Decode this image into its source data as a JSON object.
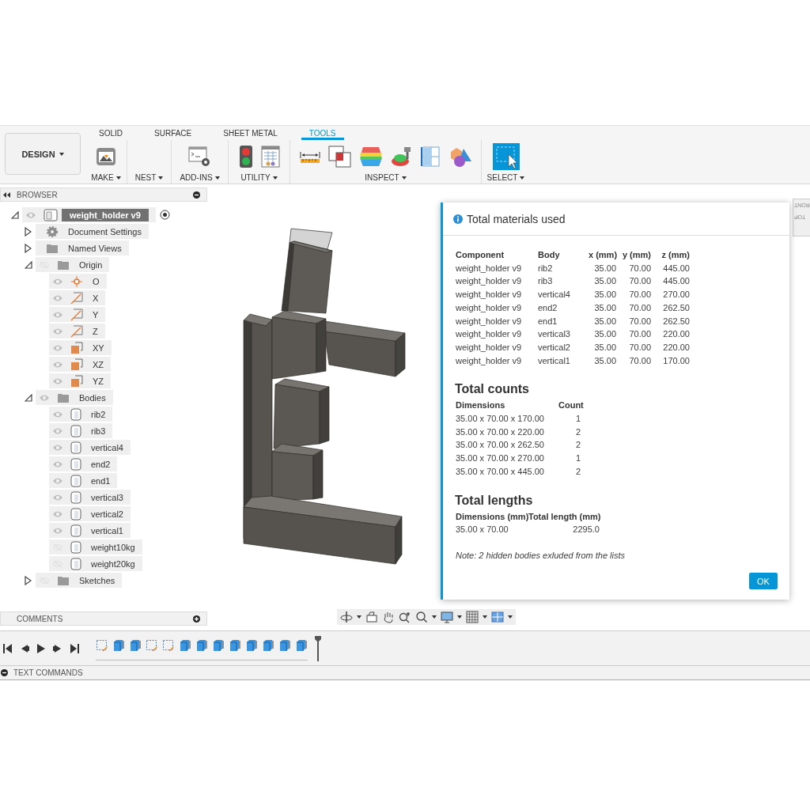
{
  "toolbar": {
    "workspace": "DESIGN",
    "tabs": [
      {
        "label": "SOLID",
        "selected": false
      },
      {
        "label": "SURFACE",
        "selected": false
      },
      {
        "label": "SHEET METAL",
        "selected": false
      },
      {
        "label": "TOOLS",
        "selected": true
      }
    ],
    "groups": [
      {
        "label": "MAKE"
      },
      {
        "label": "NEST"
      },
      {
        "label": "ADD-INS"
      },
      {
        "label": "UTILITY"
      },
      {
        "label": "INSPECT"
      },
      {
        "label": "SELECT"
      }
    ]
  },
  "browser": {
    "title": "BROWSER",
    "tree": [
      {
        "label": "weight_holder v9",
        "kind": "component",
        "visible": true,
        "expanded": true,
        "active": true,
        "children": [
          {
            "label": "Document Settings",
            "kind": "settings",
            "expanded": false
          },
          {
            "label": "Named Views",
            "kind": "folder",
            "expanded": false
          },
          {
            "label": "Origin",
            "kind": "folder",
            "visible": false,
            "expanded": true,
            "children": [
              {
                "label": "O",
                "kind": "point",
                "visible": true
              },
              {
                "label": "X",
                "kind": "axis",
                "visible": true
              },
              {
                "label": "Y",
                "kind": "axis",
                "visible": true
              },
              {
                "label": "Z",
                "kind": "axis",
                "visible": true
              },
              {
                "label": "XY",
                "kind": "plane",
                "visible": true
              },
              {
                "label": "XZ",
                "kind": "plane",
                "visible": true
              },
              {
                "label": "YZ",
                "kind": "plane",
                "visible": true
              }
            ]
          },
          {
            "label": "Bodies",
            "kind": "folder",
            "visible": true,
            "expanded": true,
            "children": [
              {
                "label": "rib2",
                "kind": "body",
                "visible": true
              },
              {
                "label": "rib3",
                "kind": "body",
                "visible": true
              },
              {
                "label": "vertical4",
                "kind": "body",
                "visible": true
              },
              {
                "label": "end2",
                "kind": "body",
                "visible": true
              },
              {
                "label": "end1",
                "kind": "body",
                "visible": true
              },
              {
                "label": "vertical3",
                "kind": "body",
                "visible": true
              },
              {
                "label": "vertical2",
                "kind": "body",
                "visible": true
              },
              {
                "label": "vertical1",
                "kind": "body",
                "visible": true
              },
              {
                "label": "weight10kg",
                "kind": "body",
                "visible": false
              },
              {
                "label": "weight20kg",
                "kind": "body",
                "visible": false
              }
            ]
          },
          {
            "label": "Sketches",
            "kind": "folder",
            "visible": false,
            "expanded": false
          }
        ]
      }
    ]
  },
  "comments": {
    "title": "COMMENTS"
  },
  "view_cube": {
    "labels": [
      "RONT",
      "TOP"
    ]
  },
  "dialog": {
    "title": "Total materials used",
    "materials": {
      "columns": [
        "Component",
        "Body",
        "x (mm)",
        "y (mm)",
        "z (mm)"
      ],
      "rows": [
        [
          "weight_holder v9",
          "rib2",
          "35.00",
          "70.00",
          "445.00"
        ],
        [
          "weight_holder v9",
          "rib3",
          "35.00",
          "70.00",
          "445.00"
        ],
        [
          "weight_holder v9",
          "vertical4",
          "35.00",
          "70.00",
          "270.00"
        ],
        [
          "weight_holder v9",
          "end2",
          "35.00",
          "70.00",
          "262.50"
        ],
        [
          "weight_holder v9",
          "end1",
          "35.00",
          "70.00",
          "262.50"
        ],
        [
          "weight_holder v9",
          "vertical3",
          "35.00",
          "70.00",
          "220.00"
        ],
        [
          "weight_holder v9",
          "vertical2",
          "35.00",
          "70.00",
          "220.00"
        ],
        [
          "weight_holder v9",
          "vertical1",
          "35.00",
          "70.00",
          "170.00"
        ]
      ]
    },
    "counts": {
      "heading": "Total counts",
      "columns": [
        "Dimensions",
        "Count"
      ],
      "rows": [
        [
          "35.00 x 70.00 x 170.00",
          "1"
        ],
        [
          "35.00 x 70.00 x 220.00",
          "2"
        ],
        [
          "35.00 x 70.00 x 262.50",
          "2"
        ],
        [
          "35.00 x 70.00 x 270.00",
          "1"
        ],
        [
          "35.00 x 70.00 x 445.00",
          "2"
        ]
      ]
    },
    "lengths": {
      "heading": "Total lengths",
      "columns": [
        "Dimensions (mm)",
        "Total length (mm)"
      ],
      "rows": [
        [
          "35.00 x 70.00",
          "2295.0"
        ]
      ]
    },
    "note": "Note: 2 hidden bodies exluded from the lists",
    "ok_button": "OK"
  },
  "timeline": {
    "features": [
      {
        "kind": "sketch"
      },
      {
        "kind": "extrude"
      },
      {
        "kind": "extrude"
      },
      {
        "kind": "sketch"
      },
      {
        "kind": "sketch"
      },
      {
        "kind": "extrude"
      },
      {
        "kind": "extrude"
      },
      {
        "kind": "extrude"
      },
      {
        "kind": "extrude"
      },
      {
        "kind": "extrude"
      },
      {
        "kind": "extrude"
      },
      {
        "kind": "extrude"
      },
      {
        "kind": "extrude"
      }
    ]
  },
  "text_commands": {
    "title": "TEXT COMMANDS"
  }
}
